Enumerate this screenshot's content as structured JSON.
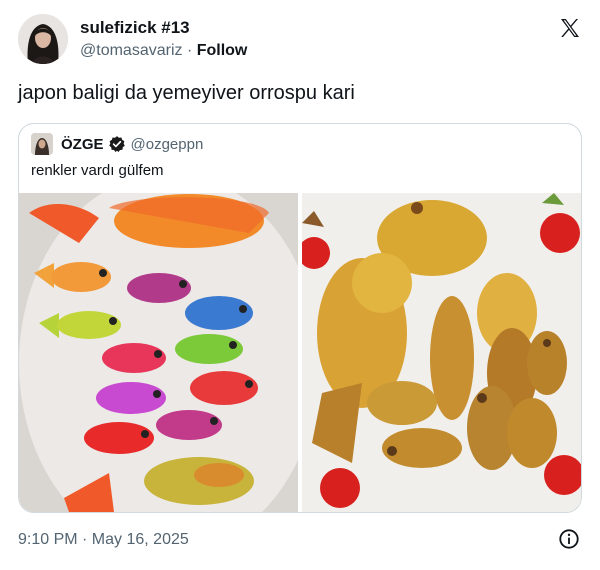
{
  "author": {
    "display_name": "sulefizick #13",
    "handle": "@tomasavariz",
    "separator": " · ",
    "follow_label": "Follow"
  },
  "tweet": {
    "text": "japon baligi da yemeyiver orrospu kari"
  },
  "quoted": {
    "display_name": "ÖZGE",
    "handle": "@ozgeppn",
    "text": "renkler vardı gülfem",
    "verified_icon": "verified-badge-icon"
  },
  "media": [
    {
      "name": "raw-colorful-fish-photo"
    },
    {
      "name": "fried-fish-photo"
    }
  ],
  "footer": {
    "timestamp": "9:10 PM · May 16, 2025"
  },
  "icons": {
    "logo": "x-logo-icon",
    "info": "info-icon"
  },
  "colors": {
    "text": "#0f1419",
    "secondary": "#536471",
    "border": "#cfd9de"
  }
}
